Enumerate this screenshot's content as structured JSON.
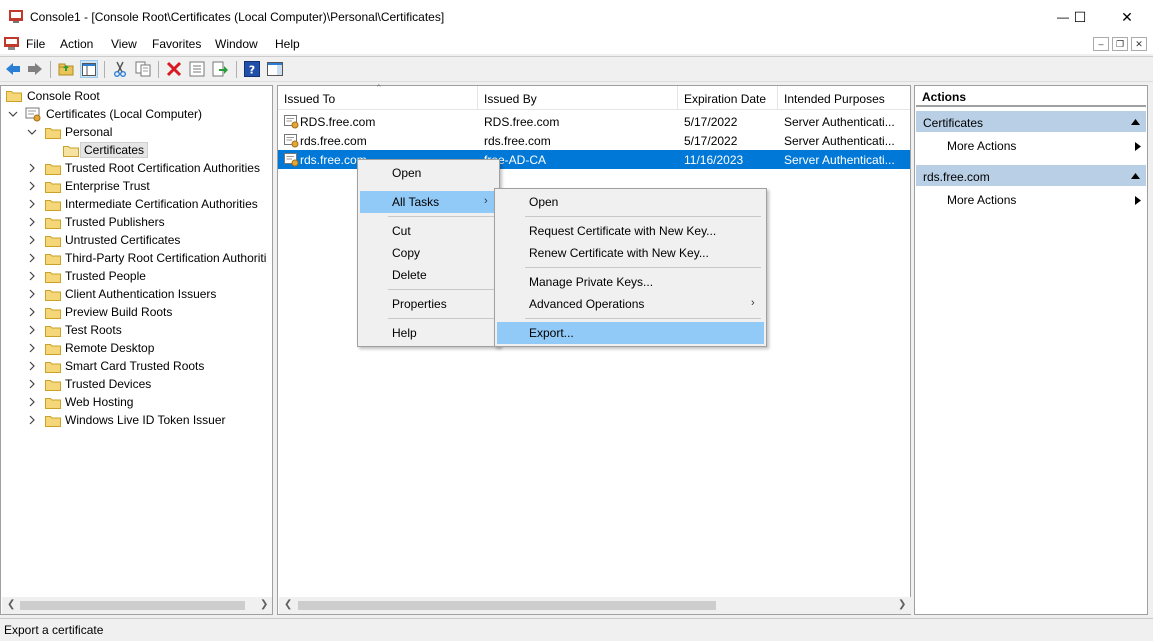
{
  "window": {
    "title": "Console1 - [Console Root\\Certificates (Local Computer)\\Personal\\Certificates]",
    "minimize_glyph": "—",
    "maximize_glyph": "☐",
    "close_glyph": "✕"
  },
  "menu": [
    "File",
    "Action",
    "View",
    "Favorites",
    "Window",
    "Help"
  ],
  "tree": {
    "root": "Console Root",
    "computer": "Certificates (Local Computer)",
    "personal": "Personal",
    "selected": "Certificates",
    "stores": [
      "Trusted Root Certification Authorities",
      "Enterprise Trust",
      "Intermediate Certification Authorities",
      "Trusted Publishers",
      "Untrusted Certificates",
      "Third-Party Root Certification Authoriti",
      "Trusted People",
      "Client Authentication Issuers",
      "Preview Build Roots",
      "Test Roots",
      "Remote Desktop",
      "Smart Card Trusted Roots",
      "Trusted Devices",
      "Web Hosting",
      "Windows Live ID Token Issuer"
    ]
  },
  "list": {
    "columns": [
      "Issued To",
      "Issued By",
      "Expiration Date",
      "Intended Purposes"
    ],
    "rows": [
      {
        "issued_to": "RDS.free.com",
        "issued_by": "RDS.free.com",
        "expiration": "5/17/2022",
        "purposes": "Server Authenticati..."
      },
      {
        "issued_to": "rds.free.com",
        "issued_by": "rds.free.com",
        "expiration": "5/17/2022",
        "purposes": "Server Authenticati..."
      },
      {
        "issued_to": "rds.free.com",
        "issued_by": "free-AD-CA",
        "expiration": "11/16/2023",
        "purposes": "Server Authenticati..."
      }
    ],
    "selected_row": 2
  },
  "context_menu": {
    "items": [
      "Open",
      "All Tasks",
      "Cut",
      "Copy",
      "Delete",
      "Properties",
      "Help"
    ]
  },
  "submenu": {
    "items": [
      "Open",
      "Request Certificate with New Key...",
      "Renew Certificate with New Key...",
      "Manage Private Keys...",
      "Advanced Operations",
      "Export..."
    ],
    "highlighted": "Export..."
  },
  "actions": {
    "header": "Actions",
    "section1_title": "Certificates",
    "section1_item": "More Actions",
    "section2_title": "rds.free.com",
    "section2_item": "More Actions"
  },
  "status": {
    "text": "Export a certificate"
  },
  "colors": {
    "selection": "#0078d7",
    "menu_highlight": "#91c9f7",
    "action_section": "#b8cfe6"
  }
}
